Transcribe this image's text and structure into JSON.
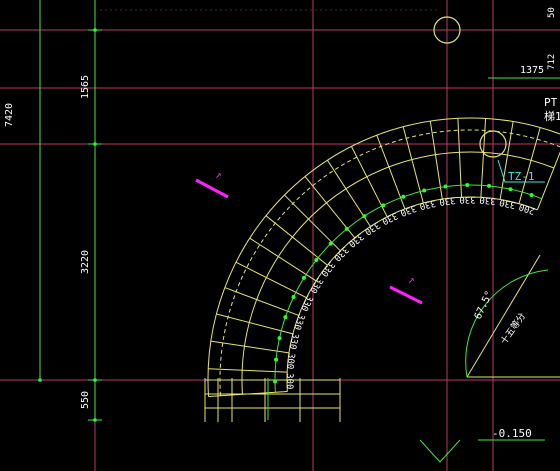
{
  "colors": {
    "background": "#000000",
    "grid_line": "#b83a62",
    "stair_line": "#e6e66a",
    "dim_line": "#3fe63f",
    "text": "#ffffff",
    "label": "#ffffff",
    "dot": "#2aff2a",
    "arrow": "#ff20ff",
    "callout": "#3fe6e6"
  },
  "dimensions_left": [
    "7420",
    "1565",
    "3220",
    "550"
  ],
  "inner_steps": [
    "300",
    "300",
    "330",
    "330",
    "330",
    "330",
    "330",
    "330",
    "330",
    "330",
    "330",
    "330",
    "330",
    "330",
    "330",
    "330",
    "330",
    "200"
  ],
  "top_labels": {
    "dim_1375": "1375",
    "pt": "PT",
    "pt_sub": "梯1",
    "top_right": "712",
    "top_right2": "50"
  },
  "tz_label": "TZ-1",
  "angle_label": "67.5°",
  "angle_sub": "十五等分",
  "elevation": "-0.150",
  "arrow_marks": [
    "↗",
    "↗"
  ]
}
